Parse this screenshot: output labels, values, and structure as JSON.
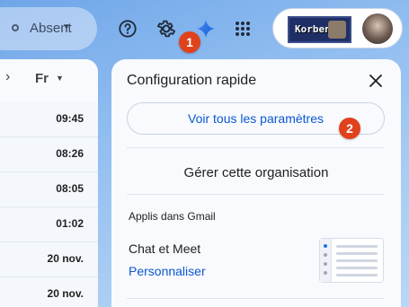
{
  "header": {
    "status_label": "Absent",
    "account_logo_text": "Korben",
    "badge_1": "1",
    "badge_2": "2"
  },
  "mail_list": {
    "language_label": "Fr",
    "times": [
      "09:45",
      "08:26",
      "08:05",
      "01:02",
      "20 nov.",
      "20 nov."
    ]
  },
  "quick_settings": {
    "title": "Configuration rapide",
    "see_all_settings": "Voir tous les paramètres",
    "manage_org": "Gérer cette organisation",
    "section_apps": "Applis dans Gmail",
    "chat_meet_label": "Chat et Meet",
    "customize_link": "Personnaliser"
  },
  "colors": {
    "accent_blue": "#0b57d0",
    "badge_red": "#e0421c",
    "gear_active_bg": "#d3e3fd"
  },
  "icons": {
    "status": "circle-status-icon",
    "help": "help-icon",
    "settings": "gear-icon",
    "gemini": "sparkle-icon",
    "apps": "grid-apps-icon",
    "close": "close-icon"
  }
}
